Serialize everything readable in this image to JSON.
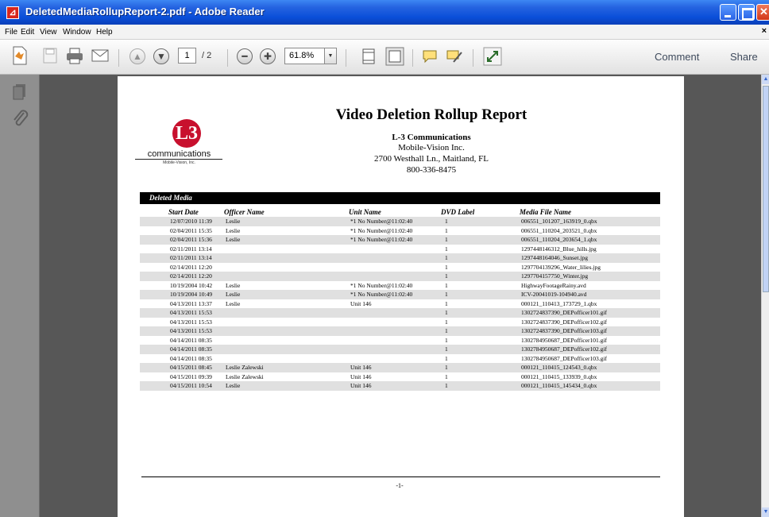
{
  "window": {
    "title": "DeletedMediaRollupReport-2.pdf - Adobe Reader"
  },
  "menu": {
    "items": [
      "File",
      "Edit",
      "View",
      "Window",
      "Help"
    ],
    "close": "×"
  },
  "toolbar": {
    "current_page": "1",
    "page_total": "/ 2",
    "zoom": "61.8%",
    "comment": "Comment",
    "share": "Share"
  },
  "icons": [
    "create-pdf-icon",
    "save-icon",
    "print-icon",
    "email-icon",
    "previous-page-icon",
    "next-page-icon",
    "zoom-out-icon",
    "zoom-in-icon",
    "fit-page-icon",
    "fit-width-icon",
    "sticky-note-icon",
    "highlight-icon",
    "full-screen-icon",
    "pages-panel-icon",
    "attachments-icon"
  ],
  "report": {
    "logo_text": "communications",
    "logo_sub": "Mobile-Vision, Inc.",
    "title": "Video Deletion Rollup Report",
    "company": "L-3 Communications",
    "division": "Mobile-Vision Inc.",
    "address": "2700 Westhall Ln., Maitland, FL",
    "phone": "800-336-8475",
    "section": "Deleted Media",
    "columns": [
      "Start Date",
      "Officer Name",
      "Unit Name",
      "DVD Label",
      "Media File Name"
    ],
    "rows": [
      [
        "12/07/2010 11:39",
        "Leslie",
        "*1 No Number@11:02:40",
        "1",
        "006551_101207_163919_0.qbx"
      ],
      [
        "02/04/2011 15:35",
        "Leslie",
        "*1 No Number@11:02:40",
        "1",
        "006551_110204_203521_0.qbx"
      ],
      [
        "02/04/2011 15:36",
        "Leslie",
        "*1 No Number@11:02:40",
        "1",
        "006551_110204_203654_1.qbx"
      ],
      [
        "02/11/2011 13:14",
        "",
        "",
        "1",
        "1297448146312_Blue_hills.jpg"
      ],
      [
        "02/11/2011 13:14",
        "",
        "",
        "1",
        "1297448164046_Sunset.jpg"
      ],
      [
        "02/14/2011 12:20",
        "",
        "",
        "1",
        "1297704139296_Water_lilies.jpg"
      ],
      [
        "02/14/2011 12:20",
        "",
        "",
        "1",
        "1297704157750_Winter.jpg"
      ],
      [
        "10/19/2004 10:42",
        "Leslie",
        "*1 No Number@11:02:40",
        "1",
        "HighwayFootageRainy.avd"
      ],
      [
        "10/19/2004 10:49",
        "Leslie",
        "*1 No Number@11:02:40",
        "1",
        "ICV-20041019-104940.avd"
      ],
      [
        "04/13/2011 13:37",
        "Leslie",
        "Unit 146",
        "1",
        "000121_110413_173729_1.qbx"
      ],
      [
        "04/13/2011 15:53",
        "",
        "",
        "1",
        "1302724837390_DEPofficer101.gif"
      ],
      [
        "04/13/2011 15:53",
        "",
        "",
        "1",
        "1302724837390_DEPofficer102.gif"
      ],
      [
        "04/13/2011 15:53",
        "",
        "",
        "1",
        "1302724837390_DEPofficer103.gif"
      ],
      [
        "04/14/2011 08:35",
        "",
        "",
        "1",
        "1302784950687_DEPofficer101.gif"
      ],
      [
        "04/14/2011 08:35",
        "",
        "",
        "1",
        "1302784950687_DEPofficer102.gif"
      ],
      [
        "04/14/2011 08:35",
        "",
        "",
        "1",
        "1302784950687_DEPofficer103.gif"
      ],
      [
        "04/15/2011 08:45",
        "Leslie Zalewski",
        "Unit 146",
        "1",
        "000121_110415_124543_0.qbx"
      ],
      [
        "04/15/2011 09:39",
        "Leslie Zalewski",
        "Unit 146",
        "1",
        "000121_110415_133939_0.qbx"
      ],
      [
        "04/15/2011 10:54",
        "Leslie",
        "Unit 146",
        "1",
        "000121_110415_145434_0.qbx"
      ]
    ],
    "footer": "-1-"
  }
}
